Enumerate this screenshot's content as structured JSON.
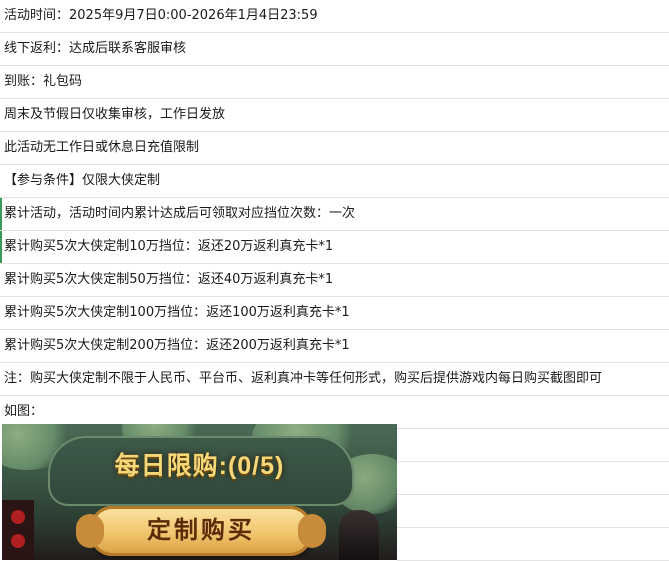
{
  "lines": [
    "活动时间：2025年9月7日0:00-2026年1月4日23:59",
    "线下返利：达成后联系客服审核",
    "到账：礼包码",
    "周末及节假日仅收集审核，工作日发放",
    "此活动无工作日或休息日充值限制",
    "【参与条件】仅限大侠定制",
    "累计活动，活动时间内累计达成后可领取对应挡位次数：一次",
    "累计购买5次大侠定制10万挡位：返还20万返利真充卡*1",
    "累计购买5次大侠定制50万挡位：返还40万返利真充卡*1",
    "累计购买5次大侠定制100万挡位：返还100万返利真充卡*1",
    "累计购买5次大侠定制200万挡位：返还200万返利真充卡*1",
    "注：购买大侠定制不限于人民币、平台币、返利真冲卡等任何形式，购买后提供游戏内每日购买截图即可",
    "如图："
  ],
  "banner": {
    "counter_text": "每日限购:(0/5)",
    "button_label": "定制购买"
  },
  "colors": {
    "row_border": "#e3e3e3",
    "accent_bar": "#3a9a5c",
    "counter_gold": "#f6d878",
    "button_gold": "#f1c56d"
  }
}
